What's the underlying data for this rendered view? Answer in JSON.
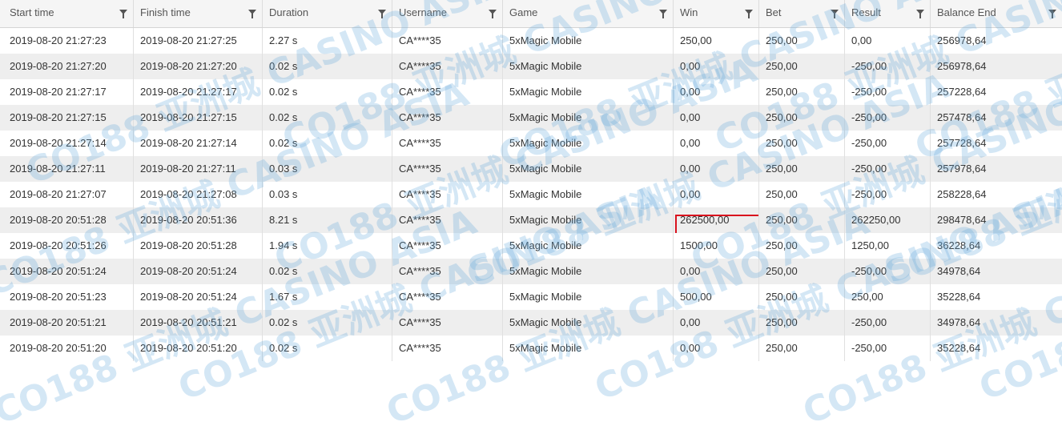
{
  "table": {
    "columns": [
      {
        "label": "Start time",
        "filter_icon": "filter-icon"
      },
      {
        "label": "Finish time",
        "filter_icon": "filter-icon"
      },
      {
        "label": "Duration",
        "filter_icon": "filter-icon"
      },
      {
        "label": "Username",
        "filter_icon": "filter-icon"
      },
      {
        "label": "Game",
        "filter_icon": "filter-icon"
      },
      {
        "label": "Win",
        "filter_icon": "filter-icon"
      },
      {
        "label": "Bet",
        "filter_icon": "filter-icon"
      },
      {
        "label": "Result",
        "filter_icon": "filter-icon"
      },
      {
        "label": "Balance End",
        "filter_icon": "filter-icon"
      }
    ],
    "rows": [
      [
        "2019-08-20 21:27:23",
        "2019-08-20 21:27:25",
        "2.27 s",
        "CA****35",
        "5xMagic Mobile",
        "250,00",
        "250,00",
        "0,00",
        "256978,64"
      ],
      [
        "2019-08-20 21:27:20",
        "2019-08-20 21:27:20",
        "0.02 s",
        "CA****35",
        "5xMagic Mobile",
        "0,00",
        "250,00",
        "-250,00",
        "256978,64"
      ],
      [
        "2019-08-20 21:27:17",
        "2019-08-20 21:27:17",
        "0.02 s",
        "CA****35",
        "5xMagic Mobile",
        "0,00",
        "250,00",
        "-250,00",
        "257228,64"
      ],
      [
        "2019-08-20 21:27:15",
        "2019-08-20 21:27:15",
        "0.02 s",
        "CA****35",
        "5xMagic Mobile",
        "0,00",
        "250,00",
        "-250,00",
        "257478,64"
      ],
      [
        "2019-08-20 21:27:14",
        "2019-08-20 21:27:14",
        "0.02 s",
        "CA****35",
        "5xMagic Mobile",
        "0,00",
        "250,00",
        "-250,00",
        "257728,64"
      ],
      [
        "2019-08-20 21:27:11",
        "2019-08-20 21:27:11",
        "0.03 s",
        "CA****35",
        "5xMagic Mobile",
        "0,00",
        "250,00",
        "-250,00",
        "257978,64"
      ],
      [
        "2019-08-20 21:27:07",
        "2019-08-20 21:27:08",
        "0.03 s",
        "CA****35",
        "5xMagic Mobile",
        "0,00",
        "250,00",
        "-250,00",
        "258228,64"
      ],
      [
        "2019-08-20 20:51:28",
        "2019-08-20 20:51:36",
        "8.21 s",
        "CA****35",
        "5xMagic Mobile",
        "262500,00",
        "250,00",
        "262250,00",
        "298478,64"
      ],
      [
        "2019-08-20 20:51:26",
        "2019-08-20 20:51:28",
        "1.94 s",
        "CA****35",
        "5xMagic Mobile",
        "1500,00",
        "250,00",
        "1250,00",
        "36228,64"
      ],
      [
        "2019-08-20 20:51:24",
        "2019-08-20 20:51:24",
        "0.02 s",
        "CA****35",
        "5xMagic Mobile",
        "0,00",
        "250,00",
        "-250,00",
        "34978,64"
      ],
      [
        "2019-08-20 20:51:23",
        "2019-08-20 20:51:24",
        "1.67 s",
        "CA****35",
        "5xMagic Mobile",
        "500,00",
        "250,00",
        "250,00",
        "35228,64"
      ],
      [
        "2019-08-20 20:51:21",
        "2019-08-20 20:51:21",
        "0.02 s",
        "CA****35",
        "5xMagic Mobile",
        "0,00",
        "250,00",
        "-250,00",
        "34978,64"
      ],
      [
        "2019-08-20 20:51:20",
        "2019-08-20 20:51:20",
        "0.02 s",
        "CA****35",
        "5xMagic Mobile",
        "0,00",
        "250,00",
        "-250,00",
        "35228,64"
      ]
    ],
    "highlighted_row": 7,
    "highlighted_column": 5
  },
  "watermark": {
    "text": "CO188 亚洲城 CASINO ASIA",
    "color": "#64aadc"
  },
  "colors": {
    "header_bg": "#f5f5f5",
    "row_alt_bg": "#eeeeee",
    "highlight_border": "#d9131e",
    "text": "#333333"
  }
}
